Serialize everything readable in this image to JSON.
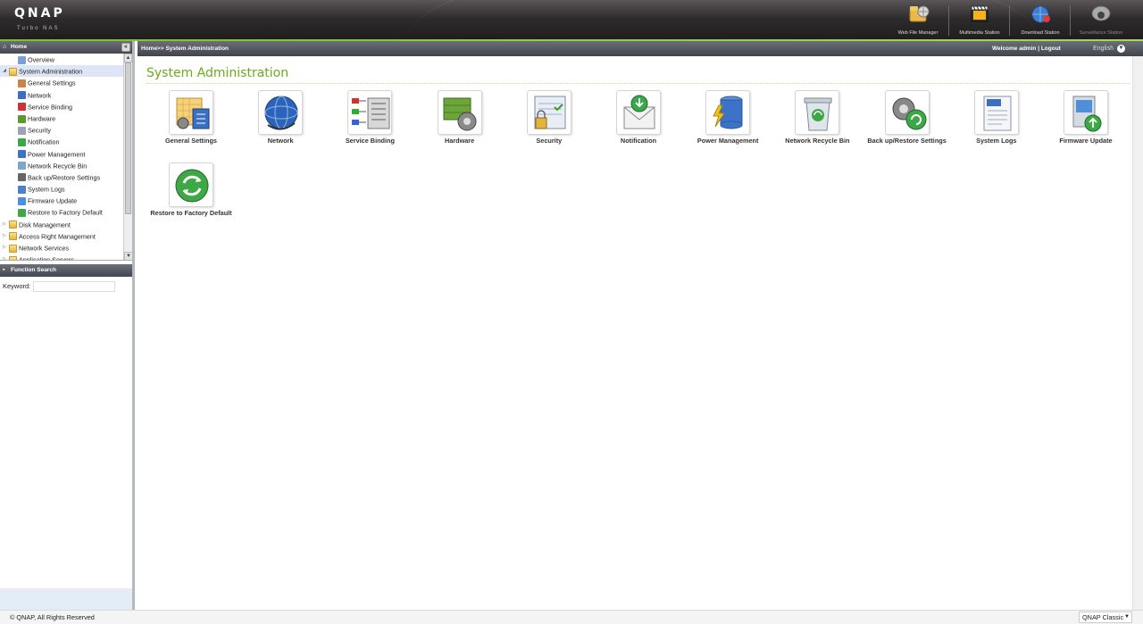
{
  "header": {
    "logo": "QNAP",
    "logo_sub": "Turbo NAS",
    "apps": [
      {
        "label": "Web File Manager",
        "icon": "web-file-manager-icon"
      },
      {
        "label": "Multimedia Station",
        "icon": "multimedia-station-icon"
      },
      {
        "label": "Download Station",
        "icon": "download-station-icon"
      },
      {
        "label": "Surveillance Station",
        "icon": "surveillance-station-icon"
      }
    ]
  },
  "sidebar": {
    "home_label": "Home",
    "tree": [
      {
        "label": "Overview",
        "level": 1,
        "icon": "overview-icon"
      },
      {
        "label": "System Administration",
        "level": 0,
        "icon": "folder-icon",
        "expanded": true,
        "selected": true
      },
      {
        "label": "General Settings",
        "level": 1,
        "icon": "general-settings-icon"
      },
      {
        "label": "Network",
        "level": 1,
        "icon": "network-icon"
      },
      {
        "label": "Service Binding",
        "level": 1,
        "icon": "service-binding-icon"
      },
      {
        "label": "Hardware",
        "level": 1,
        "icon": "hardware-icon"
      },
      {
        "label": "Security",
        "level": 1,
        "icon": "security-icon"
      },
      {
        "label": "Notification",
        "level": 1,
        "icon": "notification-icon"
      },
      {
        "label": "Power Management",
        "level": 1,
        "icon": "power-management-icon"
      },
      {
        "label": "Network Recycle Bin",
        "level": 1,
        "icon": "recycle-bin-icon"
      },
      {
        "label": "Back up/Restore Settings",
        "level": 1,
        "icon": "backup-restore-icon"
      },
      {
        "label": "System Logs",
        "level": 1,
        "icon": "system-logs-icon"
      },
      {
        "label": "Firmware Update",
        "level": 1,
        "icon": "firmware-update-icon"
      },
      {
        "label": "Restore to Factory Default",
        "level": 1,
        "icon": "factory-default-icon"
      },
      {
        "label": "Disk Management",
        "level": 0,
        "icon": "folder-icon"
      },
      {
        "label": "Access Right Management",
        "level": 0,
        "icon": "folder-icon"
      },
      {
        "label": "Network Services",
        "level": 0,
        "icon": "folder-icon"
      },
      {
        "label": "Application Servers",
        "level": 0,
        "icon": "folder-icon"
      }
    ],
    "search": {
      "title": "Function Search",
      "keyword_label": "Keyword:",
      "value": "",
      "placeholder": ""
    }
  },
  "crumb": "Home>> System Administration",
  "welcome": "Welcome admin",
  "logout": "Logout",
  "language": "English",
  "main": {
    "title": "System Administration",
    "tiles": [
      {
        "label": "General Settings",
        "icon": "general-settings-icon"
      },
      {
        "label": "Network",
        "icon": "network-icon"
      },
      {
        "label": "Service Binding",
        "icon": "service-binding-icon"
      },
      {
        "label": "Hardware",
        "icon": "hardware-icon"
      },
      {
        "label": "Security",
        "icon": "security-icon"
      },
      {
        "label": "Notification",
        "icon": "notification-icon"
      },
      {
        "label": "Power Management",
        "icon": "power-management-icon"
      },
      {
        "label": "Network Recycle Bin",
        "icon": "recycle-bin-icon"
      },
      {
        "label": "Back up/Restore Settings",
        "icon": "backup-restore-icon"
      },
      {
        "label": "System Logs",
        "icon": "system-logs-icon"
      },
      {
        "label": "Firmware Update",
        "icon": "firmware-update-icon"
      },
      {
        "label": "Restore to Factory Default",
        "icon": "factory-default-icon"
      }
    ]
  },
  "footer": {
    "copyright": "© QNAP, All Rights Reserved",
    "theme": "QNAP Classic"
  },
  "colors": {
    "accent_green": "#6aaa1e",
    "header_dark": "#2e2b2c",
    "panel_head": "#55585f",
    "selected_row": "#dce6f7"
  }
}
